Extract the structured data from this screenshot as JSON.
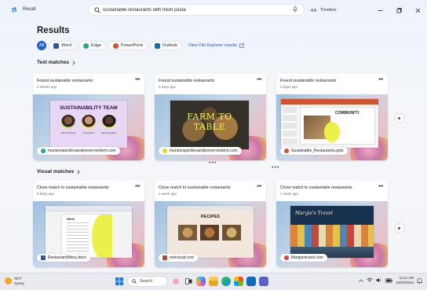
{
  "app": {
    "name": "Recall"
  },
  "search": {
    "value": "sustainable restaurants with fresh pasta",
    "placeholder": ""
  },
  "timeline_label": "Timeline",
  "results_title": "Results",
  "filters": [
    {
      "label": "All",
      "active": true
    },
    {
      "label": "Word",
      "color": "#2b579a"
    },
    {
      "label": "Edge",
      "color": "#0f8fcf"
    },
    {
      "label": "PowerPoint",
      "color": "#d35230"
    },
    {
      "label": "Outlook",
      "color": "#0f6cbd"
    }
  ],
  "file_explorer_link": "View File Explorer results",
  "text_matches": {
    "title": "Text matches",
    "cards": [
      {
        "title": "Found sustainable restaurants",
        "time": "2 weeks ago",
        "source": "munsonspicklesandpreservesfarm.com",
        "slide_title": "SUSTAINABILITY TEAM",
        "names": [
          "Ashley Schroeder",
          "Lilly Anderson",
          "Eeva Kemppainen"
        ]
      },
      {
        "title": "Found sustainable restaurants",
        "time": "3 days ago",
        "source": "munsonspicklesandpreservesfarm.com",
        "slide_title": "FARM TO TABLE"
      },
      {
        "title": "Found sustainable restaurants",
        "time": "5 days ago",
        "source": "Sustainable_Restaurants.pptx",
        "slide_title": "COMMUNITY"
      }
    ]
  },
  "visual_matches": {
    "title": "Visual matches",
    "cards": [
      {
        "title": "Close match to sustainable restaurants",
        "time": "6 days ago",
        "source": "RestaurantMenu.docx",
        "doc_heading": "MENU"
      },
      {
        "title": "Close match to sustainable restaurants",
        "time": "1 week ago",
        "source": "relecloud.com",
        "slide_title": "RECIPES"
      },
      {
        "title": "Close match to sustainable restaurants",
        "time": "1 week ago",
        "source": "Margiestravel.com",
        "slide_title": "Margie's Travel"
      }
    ]
  },
  "taskbar": {
    "weather_temp": "78°F",
    "weather_desc": "Sunny",
    "search_label": "Search",
    "time": "11:11 AM",
    "date": "10/22/2024"
  },
  "colors": {
    "accent": "#2563c8",
    "link": "#2256b6"
  }
}
